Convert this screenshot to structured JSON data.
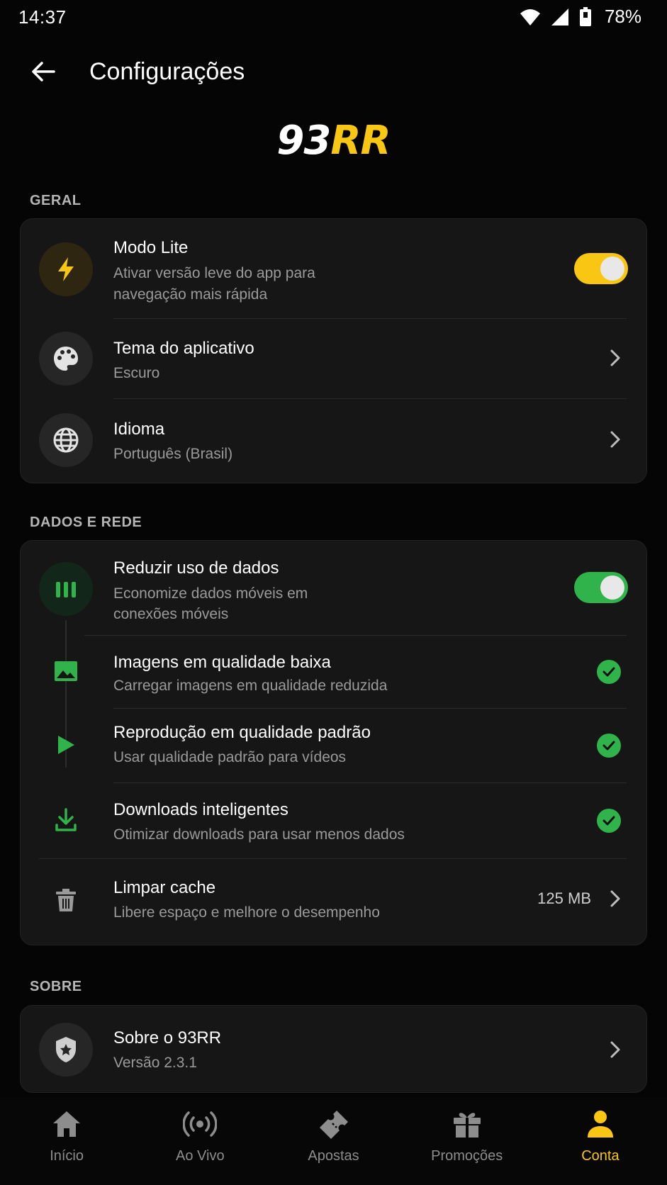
{
  "status_bar": {
    "time": "14:37",
    "battery": "78%"
  },
  "header": {
    "title": "Configurações"
  },
  "brand": {
    "part1": "93",
    "part2": "RR"
  },
  "colors": {
    "accent": "#f9c713",
    "success": "#2fb34a",
    "background": "#050505",
    "card": "#161616"
  },
  "sections": {
    "general": {
      "label": "GERAL",
      "lite_mode": {
        "title": "Modo Lite",
        "subtitle_line1": "Ativar versão leve do app para",
        "subtitle_line2": "navegação mais rápida",
        "enabled": true,
        "icon": "lightning-icon"
      },
      "theme": {
        "title": "Tema do aplicativo",
        "value": "Escuro",
        "icon": "palette-icon"
      },
      "language": {
        "title": "Idioma",
        "value": "Português (Brasil)",
        "icon": "globe-icon"
      }
    },
    "data": {
      "label": "DADOS E REDE",
      "reduce_data": {
        "title": "Reduzir uso de dados",
        "subtitle_line1": "Economize dados móveis em",
        "subtitle_line2": "conexões móveis",
        "enabled": true,
        "icon": "signal-bars-icon"
      },
      "low_images": {
        "title": "Imagens em qualidade baixa",
        "subtitle": "Carregar imagens em qualidade reduzida",
        "checked": true,
        "icon": "image-icon"
      },
      "standard_playback": {
        "title": "Reprodução em qualidade padrão",
        "subtitle": "Usar qualidade padrão para vídeos",
        "checked": true,
        "icon": "play-icon"
      },
      "smart_downloads": {
        "title": "Downloads inteligentes",
        "subtitle": "Otimizar downloads para usar menos dados",
        "checked": true,
        "icon": "download-icon"
      },
      "clear_cache": {
        "title": "Limpar cache",
        "subtitle": "Libere espaço e melhore o desempenho",
        "value": "125 MB",
        "icon": "trash-icon"
      }
    },
    "about": {
      "label": "SOBRE",
      "about_app": {
        "title": "Sobre o 93RR",
        "subtitle": "Versão 2.3.1",
        "icon": "shield-star-icon"
      }
    }
  },
  "bottom_nav": [
    {
      "label": "Início",
      "icon": "home-icon"
    },
    {
      "label": "Ao Vivo",
      "icon": "live-broadcast-icon"
    },
    {
      "label": "Apostas",
      "icon": "ticket-icon"
    },
    {
      "label": "Promoções",
      "icon": "gift-icon"
    },
    {
      "label": "Conta",
      "icon": "user-icon",
      "active": true
    }
  ]
}
